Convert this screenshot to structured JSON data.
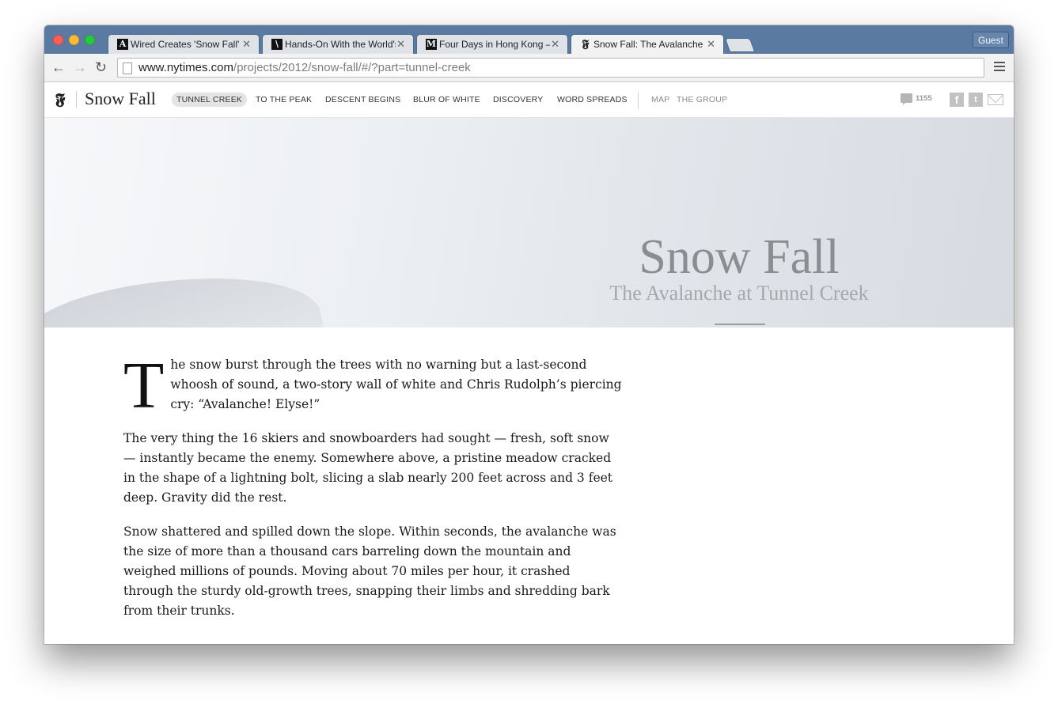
{
  "browser": {
    "tabs": [
      {
        "label": "Wired Creates 'Snow Fall' c",
        "favicon": "A"
      },
      {
        "label": "Hands-On With the World's",
        "favicon": "\\"
      },
      {
        "label": "Four Days in Hong Kong –",
        "favicon": "M"
      },
      {
        "label": "Snow Fall: The Avalanche a",
        "favicon": "𝕱"
      }
    ],
    "guest_label": "Guest",
    "url_host": "www.nytimes.com",
    "url_path": "/projects/2012/snow-fall/#/?part=tunnel-creek",
    "icons": {
      "back": "back-arrow-icon",
      "forward": "forward-arrow-icon",
      "reload": "reload-icon",
      "menu": "hamburger-menu-icon"
    }
  },
  "site": {
    "logo": "𝕱",
    "brand": "Snow Fall",
    "nav": [
      "TUNNEL CREEK",
      "TO THE PEAK",
      "DESCENT BEGINS",
      "BLUR OF WHITE",
      "DISCOVERY",
      "WORD SPREADS"
    ],
    "extra_nav": [
      "MAP",
      "THE GROUP"
    ],
    "comment_count": "1155"
  },
  "hero": {
    "title": "Snow Fall",
    "subtitle": "The Avalanche at Tunnel Creek"
  },
  "article": {
    "dropcap": "T",
    "paragraphs": [
      "he snow burst through the trees with no warning but a last-second whoosh of sound, a two-story wall of white and Chris Rudolph’s piercing cry: “Avalanche! Elyse!”",
      "The very thing the 16 skiers and snowboarders had sought — fresh, soft snow — instantly became the enemy. Somewhere above, a pristine meadow cracked in the shape of a lightning bolt, slicing a slab nearly 200 feet across and 3 feet deep. Gravity did the rest.",
      "Snow shattered and spilled down the slope. Within seconds, the avalanche was the size of more than a thousand cars barreling down the mountain and weighed millions of pounds. Moving about 70 miles per hour, it crashed through the sturdy old-growth trees, snapping their limbs and shredding bark from their trunks."
    ]
  }
}
